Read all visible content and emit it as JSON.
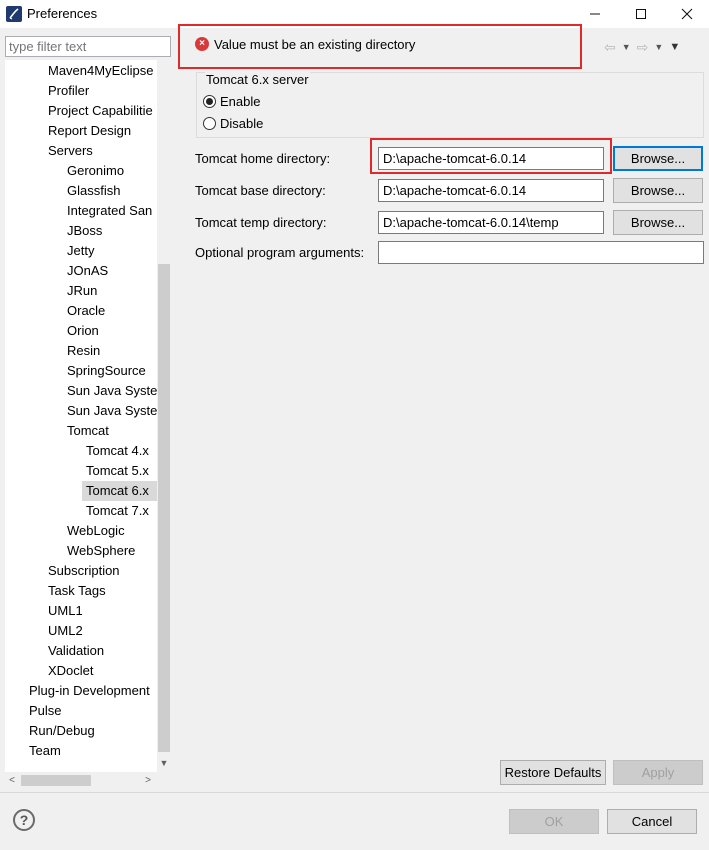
{
  "window": {
    "title": "Preferences"
  },
  "filter": {
    "placeholder": "type filter text"
  },
  "tree": {
    "items": [
      {
        "label": "Maven4MyEclipse"
      },
      {
        "label": "Profiler"
      },
      {
        "label": "Project Capabilitie"
      },
      {
        "label": "Report Design"
      },
      {
        "label": "Servers"
      },
      {
        "label": "Geronimo"
      },
      {
        "label": "Glassfish"
      },
      {
        "label": "Integrated San"
      },
      {
        "label": "JBoss"
      },
      {
        "label": "Jetty"
      },
      {
        "label": "JOnAS"
      },
      {
        "label": "JRun"
      },
      {
        "label": "Oracle"
      },
      {
        "label": "Orion"
      },
      {
        "label": "Resin"
      },
      {
        "label": "SpringSource"
      },
      {
        "label": "Sun Java Syster"
      },
      {
        "label": "Sun Java Syster"
      },
      {
        "label": "Tomcat"
      },
      {
        "label": "Tomcat  4.x"
      },
      {
        "label": "Tomcat  5.x"
      },
      {
        "label": "Tomcat  6.x"
      },
      {
        "label": "Tomcat  7.x"
      },
      {
        "label": "WebLogic"
      },
      {
        "label": "WebSphere"
      },
      {
        "label": "Subscription"
      },
      {
        "label": "Task Tags"
      },
      {
        "label": "UML1"
      },
      {
        "label": "UML2"
      },
      {
        "label": "Validation"
      },
      {
        "label": "XDoclet"
      },
      {
        "label": "Plug-in Development"
      },
      {
        "label": "Pulse"
      },
      {
        "label": "Run/Debug"
      },
      {
        "label": "Team"
      }
    ],
    "selected": "Tomcat  6.x"
  },
  "error": {
    "message": "Value must be an existing directory"
  },
  "server_group": {
    "title": "Tomcat  6.x server",
    "enable_label": "Enable",
    "disable_label": "Disable",
    "selected": "Enable"
  },
  "fields": {
    "home": {
      "label": "Tomcat home directory:",
      "value": "D:\\apache-tomcat-6.0.14",
      "browse": "Browse..."
    },
    "base": {
      "label": "Tomcat base directory:",
      "value": "D:\\apache-tomcat-6.0.14",
      "browse": "Browse..."
    },
    "temp": {
      "label": "Tomcat temp directory:",
      "value": "D:\\apache-tomcat-6.0.14\\temp",
      "browse": "Browse..."
    },
    "args": {
      "label": "Optional program arguments:",
      "value": ""
    }
  },
  "buttons": {
    "restore_defaults": "Restore Defaults",
    "apply": "Apply",
    "ok": "OK",
    "cancel": "Cancel"
  },
  "icons": {
    "help": "?",
    "error": "×"
  },
  "colors": {
    "highlight": "#e0292b",
    "focus": "#0078d7",
    "selection": "#d9d9d9"
  }
}
